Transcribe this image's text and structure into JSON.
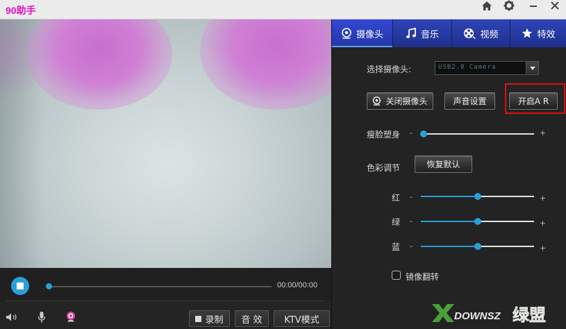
{
  "app": {
    "title": "90助手"
  },
  "titlebar_icons": [
    "home-icon",
    "gear-icon",
    "minimize-icon",
    "close-icon"
  ],
  "tabs": [
    {
      "label": "摄像头",
      "icon": "webcam-icon",
      "active": true
    },
    {
      "label": "音乐",
      "icon": "music-note-icon",
      "active": false
    },
    {
      "label": "视频",
      "icon": "film-reel-icon",
      "active": false
    },
    {
      "label": "特效",
      "icon": "star-icon",
      "active": false
    }
  ],
  "camera": {
    "select_label": "选择摄像头:",
    "select_value": "USB2.0 Camera",
    "close_camera_label": "关闭摄像头",
    "sound_settings_label": "声音设置",
    "open_ar_label": "开启A R"
  },
  "face_slim": {
    "label": "瘦脸塑身",
    "minus": "-",
    "plus": "+",
    "value": 0.0
  },
  "color_adjust": {
    "label": "色彩调节",
    "reset_label": "恢复默认",
    "channels": [
      {
        "label": "红",
        "value": 0.5
      },
      {
        "label": "绿",
        "value": 0.5
      },
      {
        "label": "蓝",
        "value": 0.5
      }
    ]
  },
  "mirror": {
    "label": "镜像翻转",
    "checked": false
  },
  "playback": {
    "time": "00:00/00:00",
    "progress": 0.0
  },
  "bottom": {
    "record_label": "录制",
    "sound_effect_label": "音 效",
    "ktv_label": "KTV模式"
  },
  "watermark": {
    "text": "DOWNSZ",
    "suffix": "绿盟"
  },
  "colors": {
    "accent": "#2a9fd8",
    "tab_blue": "#2335a8",
    "title_magenta": "#e011c6",
    "highlight_red": "#e01010"
  }
}
